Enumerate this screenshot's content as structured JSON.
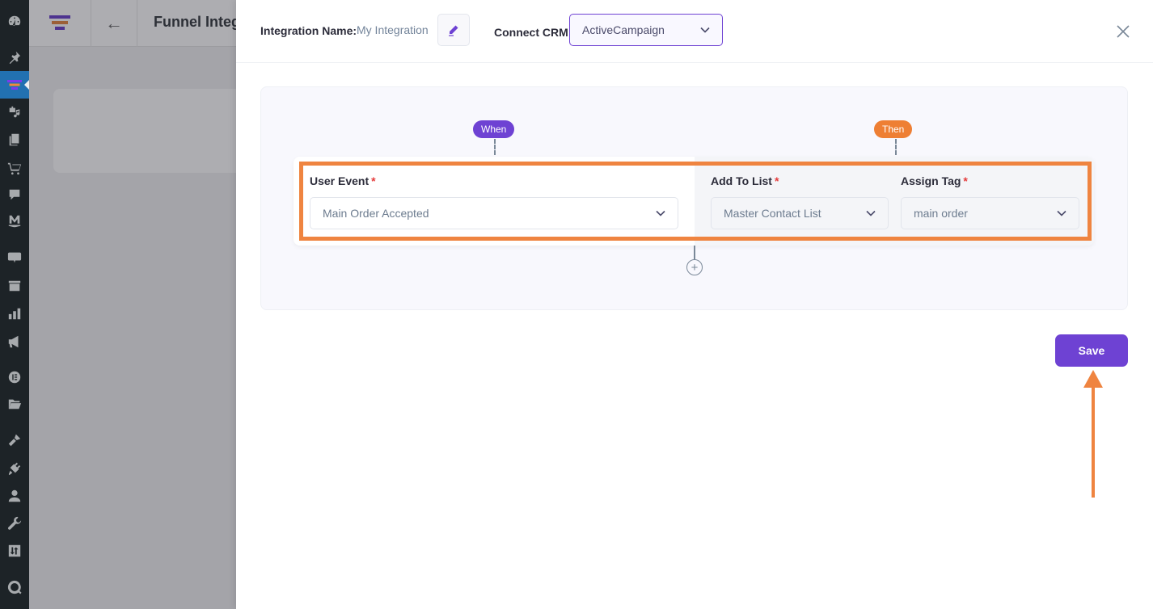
{
  "wp_sidebar": {
    "items": [
      {
        "icon": "dashboard-icon"
      },
      {
        "icon": "pin-icon"
      },
      {
        "icon": "funnel-icon",
        "active": true
      },
      {
        "icon": "media-icon"
      },
      {
        "icon": "pages-icon"
      },
      {
        "icon": "cart-icon"
      },
      {
        "icon": "comments-icon"
      },
      {
        "icon": "mail-icon"
      },
      {
        "icon": "woo-icon"
      },
      {
        "icon": "archive-icon"
      },
      {
        "icon": "analytics-icon"
      },
      {
        "icon": "megaphone-icon"
      },
      {
        "icon": "elementor-icon"
      },
      {
        "icon": "folder-icon"
      },
      {
        "icon": "brush-icon"
      },
      {
        "icon": "plugin-icon"
      },
      {
        "icon": "user-icon"
      },
      {
        "icon": "wrench-icon"
      },
      {
        "icon": "settings-icon"
      },
      {
        "icon": "q-icon"
      }
    ]
  },
  "background_page": {
    "title": "Funnel Integrations",
    "back_icon": "←"
  },
  "drawer": {
    "integration_name_label": "Integration Name:",
    "integration_name_value": "My Integration",
    "edit_icon": "pencil-icon",
    "connect_crm_label": "Connect CRM",
    "crm_selected": "ActiveCampaign",
    "close_icon": "close-icon",
    "when_label": "When",
    "then_label": "Then",
    "user_event_label": "User Event",
    "user_event_value": "Main Order Accepted",
    "add_to_list_label": "Add To List",
    "add_to_list_value": "Master Contact List",
    "assign_tag_label": "Assign Tag",
    "assign_tag_value": "main order",
    "required_marker": "*",
    "add_step_symbol": "+",
    "save_label": "Save"
  },
  "colors": {
    "primary": "#6e42d3",
    "accent_orange": "#ee7f34",
    "annotation": "#ef8440"
  }
}
